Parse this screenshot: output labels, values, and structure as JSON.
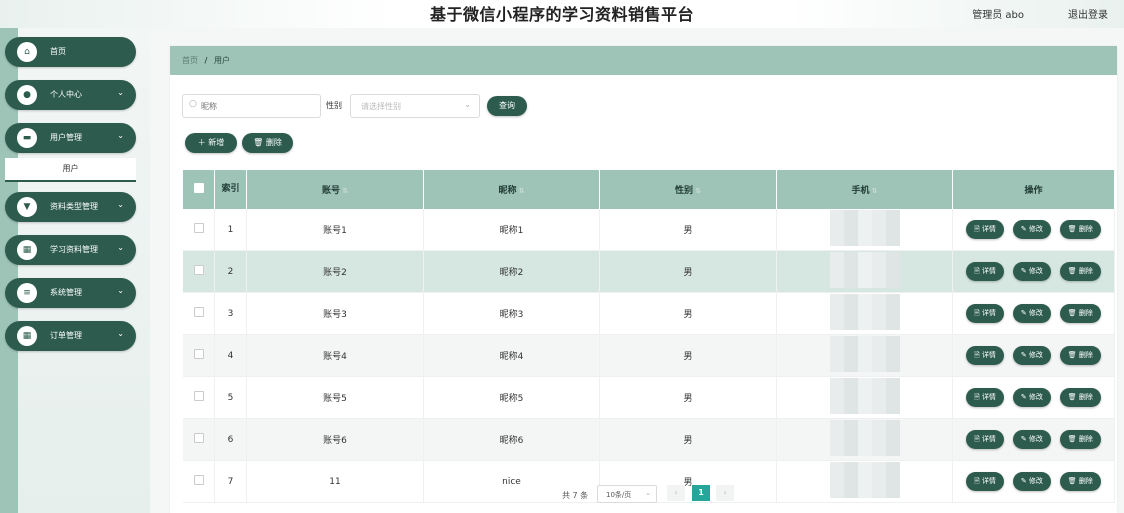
{
  "header": {
    "title": "基于微信小程序的学习资料销售平台",
    "admin": "管理员 abo",
    "logout": "退出登录"
  },
  "sidebar": {
    "items": [
      {
        "label": "首页",
        "icon": "home-icon",
        "has_chevron": false
      },
      {
        "label": "个人中心",
        "icon": "user-icon",
        "has_chevron": true
      },
      {
        "label": "用户管理",
        "icon": "users-icon",
        "has_chevron": true
      },
      {
        "label": "资料类型管理",
        "icon": "tag-icon",
        "has_chevron": true
      },
      {
        "label": "学习资料管理",
        "icon": "grid-icon",
        "has_chevron": true
      },
      {
        "label": "系统管理",
        "icon": "menu-icon",
        "has_chevron": true
      },
      {
        "label": "订单管理",
        "icon": "grid-icon",
        "has_chevron": true
      }
    ],
    "active_sub": "用户"
  },
  "breadcrumb": {
    "home": "首页",
    "separator": "/",
    "current": "用户"
  },
  "search": {
    "nickname_placeholder": "昵称",
    "gender_label": "性别",
    "gender_placeholder": "请选择性别",
    "query_button": "查询"
  },
  "actions": {
    "add": "新增",
    "delete": "删除"
  },
  "table": {
    "columns": {
      "index": "索引",
      "account": "账号",
      "nickname": "昵称",
      "gender": "性别",
      "phone": "手机",
      "ops": "操作"
    },
    "row_actions": {
      "detail": "详情",
      "edit": "修改",
      "delete": "删除"
    },
    "rows": [
      {
        "index": "1",
        "account": "账号1",
        "nickname": "昵称1",
        "gender": "男"
      },
      {
        "index": "2",
        "account": "账号2",
        "nickname": "昵称2",
        "gender": "男"
      },
      {
        "index": "3",
        "account": "账号3",
        "nickname": "昵称3",
        "gender": "男"
      },
      {
        "index": "4",
        "account": "账号4",
        "nickname": "昵称4",
        "gender": "男"
      },
      {
        "index": "5",
        "account": "账号5",
        "nickname": "昵称5",
        "gender": "男"
      },
      {
        "index": "6",
        "account": "账号6",
        "nickname": "昵称6",
        "gender": "男"
      },
      {
        "index": "7",
        "account": "11",
        "nickname": "nice",
        "gender": "男"
      }
    ]
  },
  "pagination": {
    "total": "共 7 条",
    "page_size": "10条/页",
    "current_page": "1",
    "prev": "‹",
    "next": "›"
  },
  "colors": {
    "primary": "#2d5c4e",
    "light": "#9ec4b8",
    "highlight": "#d6e7e1",
    "page_active": "#26a69a"
  }
}
